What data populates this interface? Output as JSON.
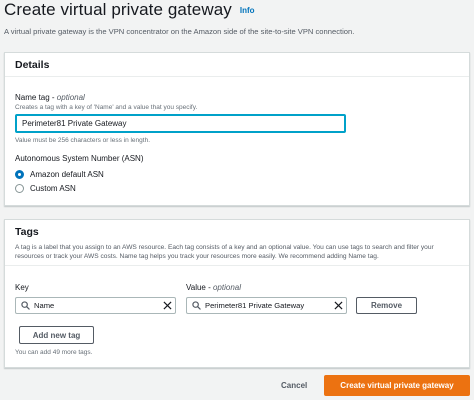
{
  "page": {
    "title": "Create virtual private gateway",
    "info_link": "Info",
    "description": "A virtual private gateway is the VPN concentrator on the Amazon side of the site-to-site VPN connection."
  },
  "details": {
    "title": "Details",
    "name_tag": {
      "label": "Name tag",
      "optional": "optional",
      "description": "Creates a tag with a key of 'Name' and a value that you specify.",
      "value": "Perimeter81 Private Gateway",
      "constraint": "Value must be 256 characters or less in length."
    },
    "asn": {
      "label": "Autonomous System Number (ASN)",
      "options": [
        {
          "label": "Amazon default ASN",
          "selected": true
        },
        {
          "label": "Custom ASN",
          "selected": false
        }
      ]
    }
  },
  "tags": {
    "title": "Tags",
    "description": "A tag is a label that you assign to an AWS resource. Each tag consists of a key and an optional value. You can use tags to search and filter your resources or track your AWS costs. Name tag helps you track your resources more easily. We recommend adding Name tag.",
    "key_label": "Key",
    "value_label": "Value",
    "value_optional": "optional",
    "rows": [
      {
        "key": "Name",
        "value": "Perimeter81 Private Gateway"
      }
    ],
    "remove_label": "Remove",
    "add_label": "Add new tag",
    "limit_text": "You can add 49 more tags."
  },
  "footer": {
    "cancel_label": "Cancel",
    "create_label": "Create virtual private gateway"
  },
  "colors": {
    "primary": "#ec7211",
    "link": "#0073bb",
    "focus": "#00a1c9"
  }
}
